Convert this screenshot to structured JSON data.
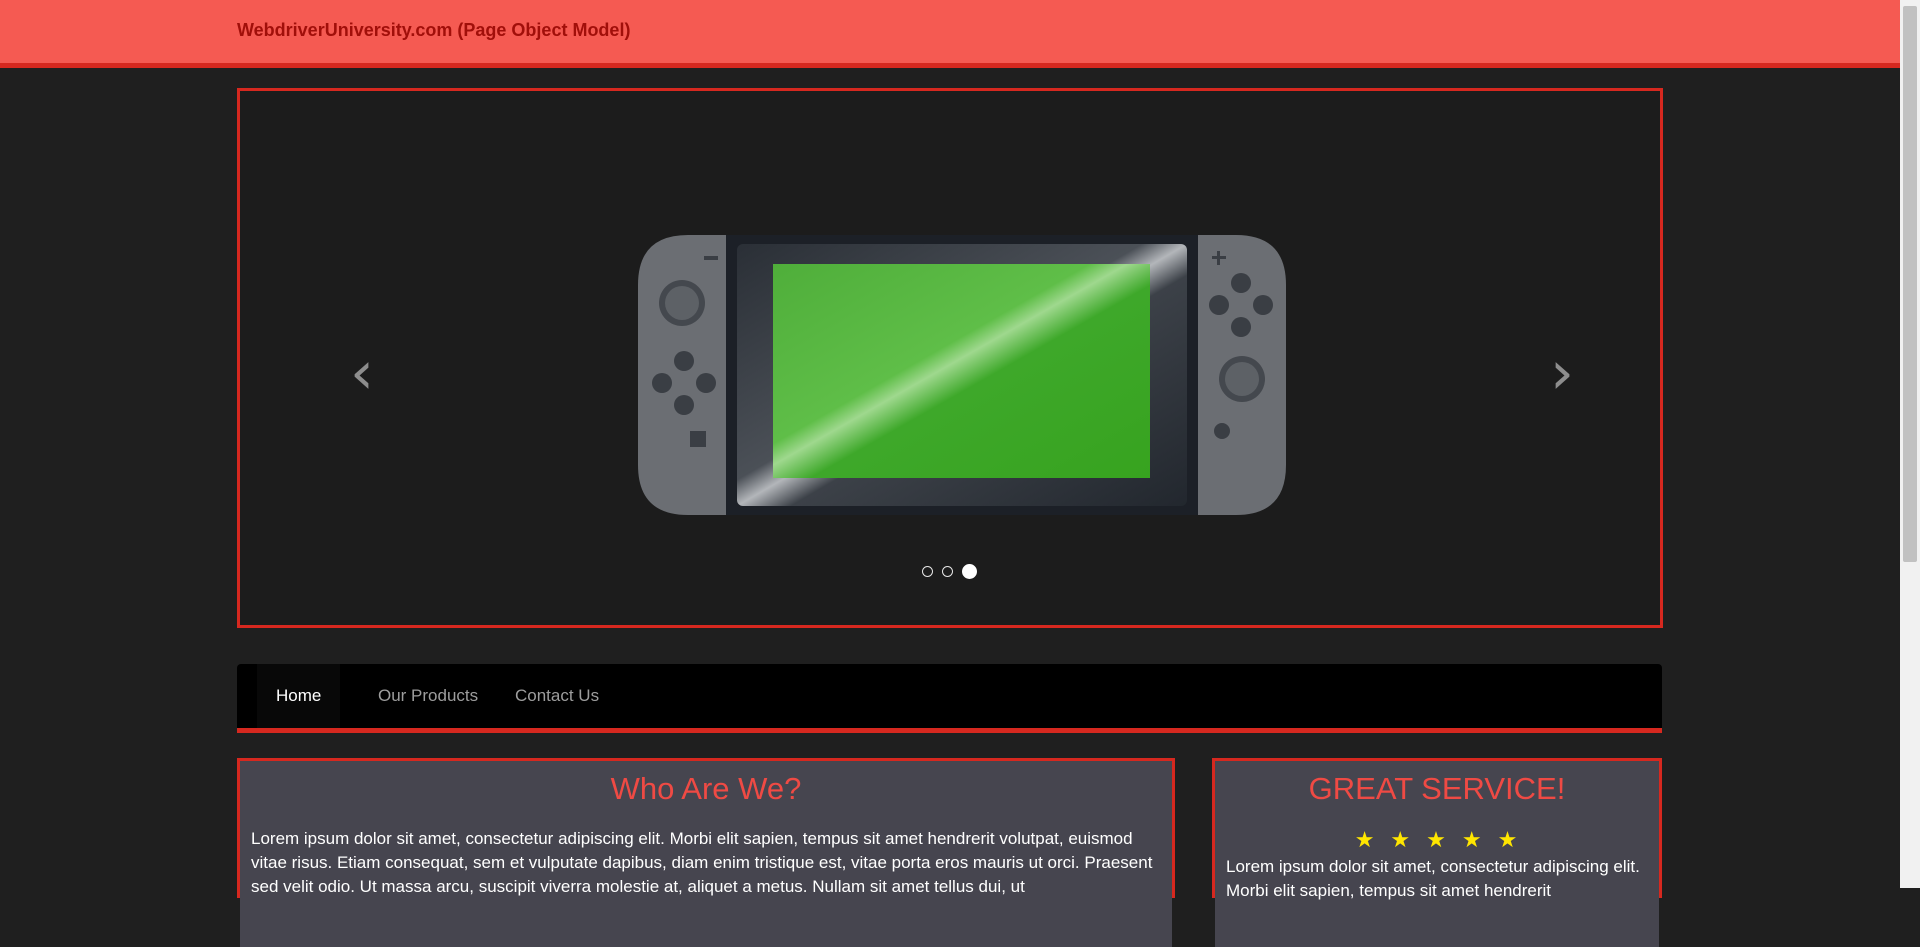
{
  "topbar": {
    "brand": "WebdriverUniversity.com (Page Object Model)",
    "color": "#f55a52"
  },
  "carousel": {
    "prev_icon": "chevron-left",
    "next_icon": "chevron-right",
    "indicators_count": 3,
    "active_indicator": 3
  },
  "nav": {
    "items": [
      {
        "label": "Home",
        "active": true
      },
      {
        "label": "Our Products",
        "active": false
      },
      {
        "label": "Contact Us",
        "active": false
      }
    ]
  },
  "panels": {
    "who": {
      "title": "Who Are We?",
      "text": "Lorem ipsum dolor sit amet, consectetur adipiscing elit. Morbi elit sapien, tempus sit amet hendrerit volutpat, euismod vitae risus. Etiam consequat, sem et vulputate dapibus, diam enim tristique est, vitae porta eros mauris ut orci. Praesent sed velit odio. Ut massa arcu, suscipit viverra molestie at, aliquet a metus. Nullam sit amet tellus dui, ut"
    },
    "service": {
      "title": "GREAT SERVICE!",
      "stars": "★★★★★",
      "text": "Lorem ipsum dolor sit amet, consectetur adipiscing elit. Morbi elit sapien, tempus sit amet hendrerit"
    }
  },
  "colors": {
    "accent": "#d6281f",
    "heading": "#ef4a44",
    "star": "#ffe600"
  }
}
